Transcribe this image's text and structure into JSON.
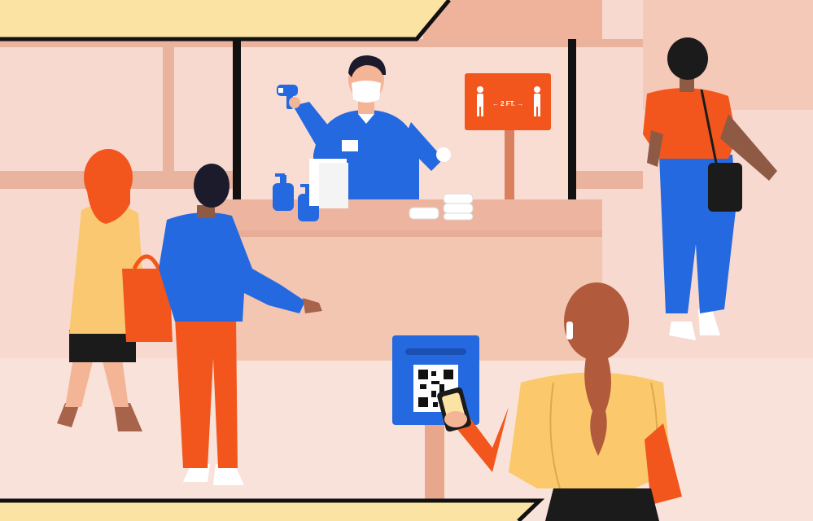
{
  "illustration": {
    "sign": {
      "text": "← 2 FT. →"
    },
    "qr_stand": {
      "icon": "qr-code-icon"
    },
    "colors": {
      "background": "#f7d9d0",
      "banner": "#fbe3a4",
      "wood": "#e8b49f",
      "counter": "#f2c6b1",
      "accent_orange": "#f2561d",
      "accent_blue": "#2469e0",
      "outline": "#111111"
    }
  }
}
